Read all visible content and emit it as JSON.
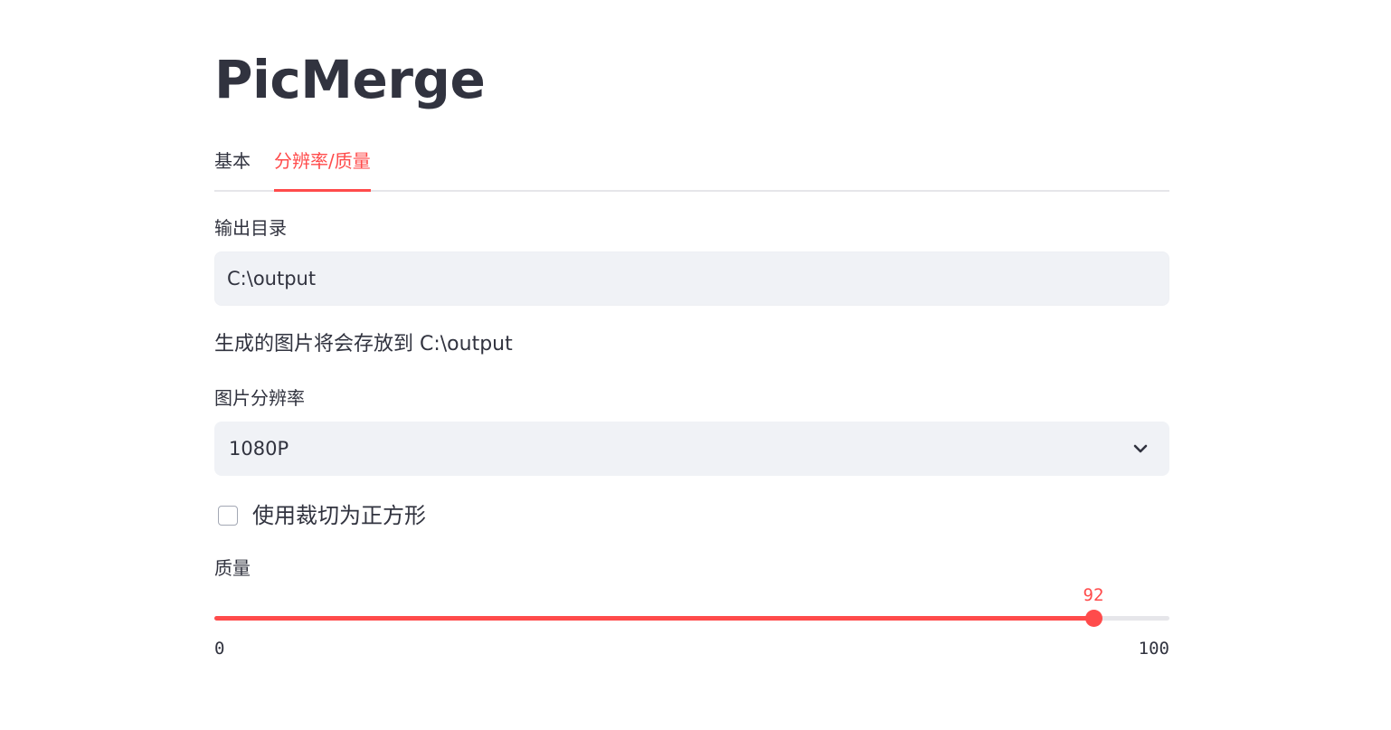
{
  "app": {
    "title": "PicMerge"
  },
  "tabs": [
    {
      "label": "基本",
      "active": false
    },
    {
      "label": "分辨率/质量",
      "active": true
    }
  ],
  "output_dir": {
    "label": "输出目录",
    "value": "C:\\output"
  },
  "info": {
    "text": "生成的图片将会存放到 C:\\output"
  },
  "resolution": {
    "label": "图片分辨率",
    "selected": "1080P",
    "icon": "chevron-down-icon"
  },
  "square_crop": {
    "label": "使用裁切为正方形",
    "checked": false
  },
  "quality": {
    "label": "质量",
    "value": 92,
    "min": 0,
    "max": 100,
    "value_text": "92",
    "min_text": "0",
    "max_text": "100"
  },
  "colors": {
    "accent": "#ff4b4b",
    "text": "#31333f",
    "input_bg": "#f0f2f6",
    "track": "#e6e6ea"
  }
}
